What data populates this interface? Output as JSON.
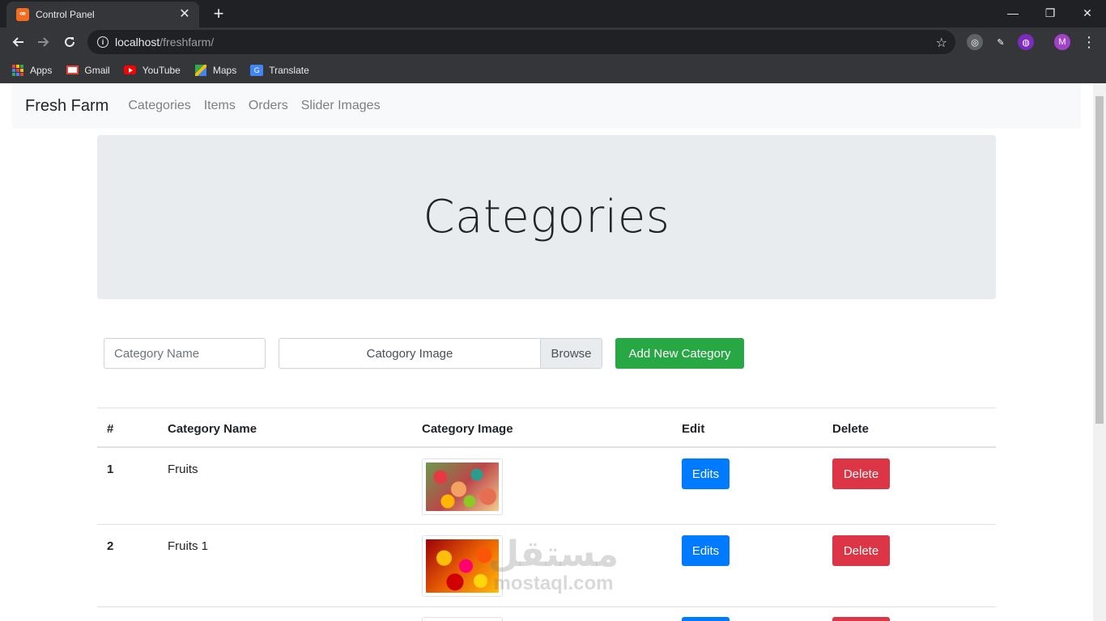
{
  "browser": {
    "tab_title": "Control Panel",
    "favicon_text": "ꟹ",
    "new_tab": "+",
    "close_tab": "✕",
    "window_controls": {
      "minimize": "—",
      "restore": "❐",
      "close": "✕"
    },
    "url_host": "localhost",
    "url_path": "/freshfarm/",
    "profile_initial": "M",
    "bookmarks": [
      {
        "label": "Apps",
        "icon": "apps-grid-icon"
      },
      {
        "label": "Gmail",
        "icon": "gmail-icon"
      },
      {
        "label": "YouTube",
        "icon": "youtube-icon"
      },
      {
        "label": "Maps",
        "icon": "maps-icon"
      },
      {
        "label": "Translate",
        "icon": "translate-icon"
      }
    ]
  },
  "navbar": {
    "brand": "Fresh Farm",
    "links": [
      "Categories",
      "Items",
      "Orders",
      "Slider Images"
    ]
  },
  "jumbotron": {
    "title": "Categories"
  },
  "form": {
    "name_placeholder": "Category Name",
    "image_label": "Catogory Image",
    "browse_label": "Browse",
    "submit_label": "Add New Category"
  },
  "table": {
    "headers": [
      "#",
      "Category Name",
      "Category Image",
      "Edit",
      "Delete"
    ],
    "rows": [
      {
        "index": "1",
        "name": "Fruits",
        "edit": "Edits",
        "delete": "Delete"
      },
      {
        "index": "2",
        "name": "Fruits 1",
        "edit": "Edits",
        "delete": "Delete"
      }
    ]
  },
  "watermark": {
    "arabic": "مستقل",
    "latin": "mostaql.com"
  },
  "colors": {
    "success": "#28a745",
    "primary": "#007bff",
    "danger": "#dc3545",
    "jumbotron_bg": "#e9ecef"
  }
}
